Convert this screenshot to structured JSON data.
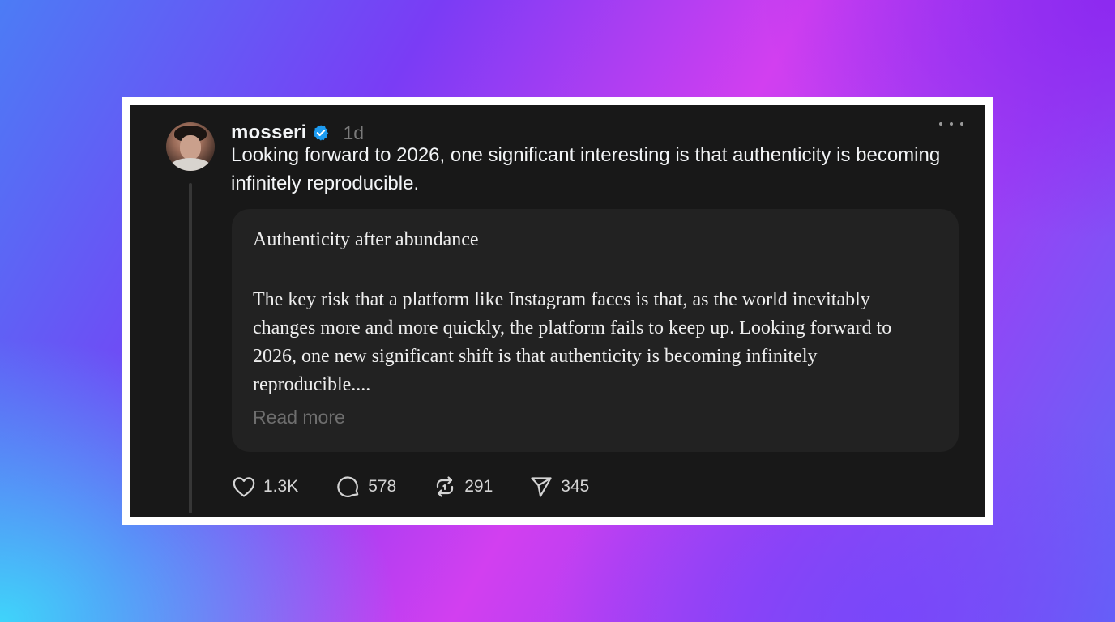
{
  "post": {
    "username": "mosseri",
    "verified_icon": "verified-badge-icon",
    "verified_color": "#1d9bf0",
    "time": "1d",
    "more_icon": "more-horizontal-icon",
    "text": "Looking forward to 2026, one significant interesting is that authenticity is becoming infinitely reproducible.",
    "avatar": "avatar-photo"
  },
  "quote": {
    "title": "Authenticity after abundance",
    "body": "The key risk that a platform like Instagram faces is that, as the world inevitably changes more and more quickly, the platform fails to keep up. Looking forward to 2026, one new significant shift is that authenticity is becoming infinitely reproducible....",
    "read_more": "Read more"
  },
  "actions": {
    "like": {
      "icon": "heart-icon",
      "count": "1.3K"
    },
    "reply": {
      "icon": "comment-icon",
      "count": "578"
    },
    "repost": {
      "icon": "repost-icon",
      "count": "291"
    },
    "share": {
      "icon": "send-icon",
      "count": "345"
    }
  },
  "colors": {
    "card_background": "#181818",
    "quote_background": "#222222",
    "text_primary": "#f3f5f7",
    "text_muted": "#7a7a7a"
  }
}
